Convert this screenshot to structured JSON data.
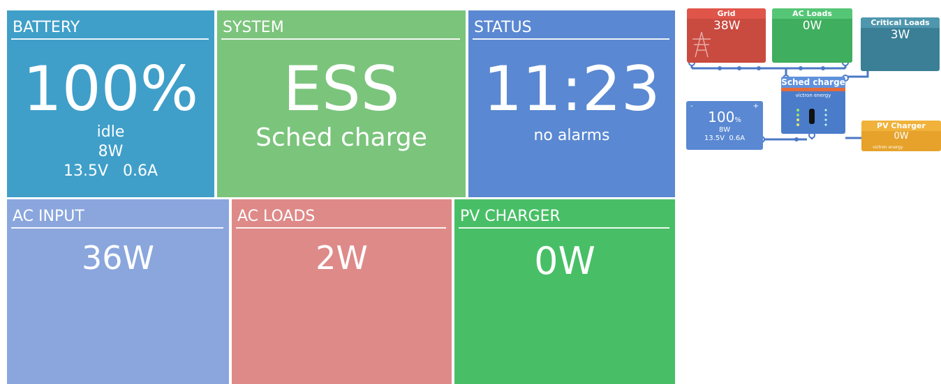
{
  "tiles": {
    "battery": {
      "title": "BATTERY",
      "soc": "100%",
      "state": "idle",
      "power": "8W",
      "volt_amp": "13.5V   0.6A"
    },
    "system": {
      "title": "SYSTEM",
      "mode": "ESS",
      "sub": "Sched charge"
    },
    "status": {
      "title": "STATUS",
      "time": "11:23",
      "alarms": "no alarms"
    },
    "ac_input": {
      "title": "AC INPUT",
      "value": "36W"
    },
    "ac_loads": {
      "title": "AC LOADS",
      "value": "2W"
    },
    "pv_charger": {
      "title": "PV CHARGER",
      "value": "0W"
    }
  },
  "overview": {
    "grid": {
      "title": "Grid",
      "value": "38W"
    },
    "ac_loads": {
      "title": "AC Loads",
      "value": "0W"
    },
    "critical_loads": {
      "title": "Critical Loads",
      "value": "3W"
    },
    "inverter": {
      "title": "Sched charge",
      "brand": "victron energy"
    },
    "battery": {
      "soc": "100",
      "unit": "%",
      "power": "8W",
      "volt_amp": "13.5V  0.6A"
    },
    "pv_charger": {
      "title": "PV Charger",
      "value": "0W",
      "brand": "victron energy"
    }
  },
  "colors": {
    "battery": "#3f9fc9",
    "system": "#7bc47c",
    "status": "#5a88d2",
    "ac_input": "#8aa6dd",
    "ac_loads": "#de8a89",
    "pv_charger": "#48bf66"
  }
}
